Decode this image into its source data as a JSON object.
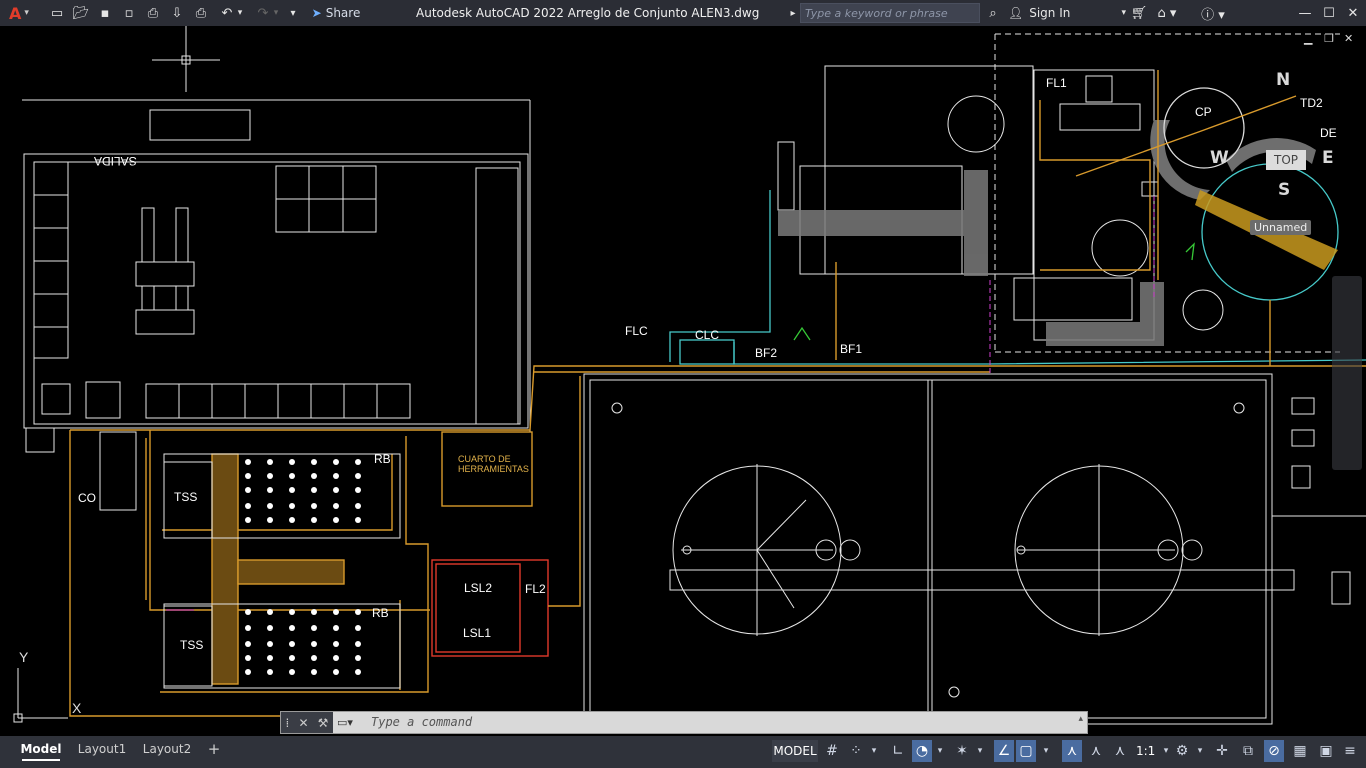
{
  "titlebar": {
    "app_logo": "A",
    "share_label": "Share",
    "title": "Autodesk AutoCAD 2022   Arreglo de Conjunto ALEN3.dwg",
    "search_placeholder": "Type a keyword or phrase",
    "sign_in": "Sign In",
    "icons": [
      "new-icon",
      "open-icon",
      "save-icon",
      "saveas-icon",
      "plot-preview-icon",
      "import-icon",
      "print-icon",
      "undo-icon",
      "redo-icon",
      "quick-access-menu-icon",
      "search-icon",
      "user-icon",
      "cart-icon",
      "autodesk-apps-icon",
      "help-icon",
      "minimize-icon",
      "maximize-icon",
      "close-icon"
    ]
  },
  "drawing": {
    "labels": {
      "salida": "SALIDA",
      "co": "CO",
      "tss_top": "TSS",
      "tss_bottom": "TSS",
      "rb_top": "RB",
      "rb_bottom": "RB",
      "cuarto": "CUARTO DE\nHERRAMIENTAS",
      "lsl2": "LSL2",
      "lsl1": "LSL1",
      "fl2": "FL2",
      "flc": "FLC",
      "clc": "CLC",
      "bf2": "BF2",
      "bf1": "BF1",
      "fl1": "FL1",
      "cp": "CP",
      "td2": "TD2",
      "de": "DE",
      "y_axis": "Y",
      "x_axis": "X"
    },
    "viewcube": {
      "n": "N",
      "s": "S",
      "w": "W",
      "e": "E",
      "top": "TOP"
    },
    "view_name": "Unnamed"
  },
  "command_line": {
    "placeholder": "Type  a  command"
  },
  "statusbar": {
    "tabs": [
      "Model",
      "Layout1",
      "Layout2"
    ],
    "add_tab": "+",
    "model_button": "MODEL",
    "scale": "1:1"
  }
}
